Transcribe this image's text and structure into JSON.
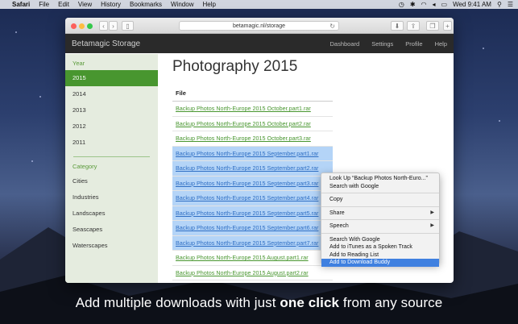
{
  "menubar": {
    "items": [
      "Safari",
      "File",
      "Edit",
      "View",
      "History",
      "Bookmarks",
      "Window",
      "Help"
    ],
    "clock": "Wed 9:41 AM"
  },
  "browser": {
    "url": "betamagic.nl/storage"
  },
  "site": {
    "brand": "Betamagic Storage",
    "nav": [
      "Dashboard",
      "Settings",
      "Profile",
      "Help"
    ]
  },
  "sidebar": {
    "year_heading": "Year",
    "years": [
      "2015",
      "2014",
      "2013",
      "2012",
      "2011"
    ],
    "category_heading": "Category",
    "categories": [
      "Cities",
      "Industries",
      "Landscapes",
      "Seascapes",
      "Waterscapes"
    ]
  },
  "main": {
    "title": "Photography 2015",
    "column_header": "File",
    "files": [
      "Backup Photos North-Europe 2015 October.part1.rar",
      "Backup Photos North-Europe 2015 October.part2.rar",
      "Backup Photos North-Europe 2015 October.part3.rar",
      "Backup Photos North-Europe 2015 September.part1.rar",
      "Backup Photos North-Europe 2015 September.part2.rar",
      "Backup Photos North-Europe 2015 September.part3.rar",
      "Backup Photos North-Europe 2015 September.part4.rar",
      "Backup Photos North-Europe 2015 September.part5.rar",
      "Backup Photos North-Europe 2015 September.part6.rar",
      "Backup Photos North-Europe 2015 September.part7.rar",
      "Backup Photos North-Europe 2015 August.part1.rar",
      "Backup Photos North-Europe 2015 August.part2.rar"
    ]
  },
  "context_menu": {
    "look_up": "Look Up “Backup Photos North-Euro...”",
    "search_google": "Search with Google",
    "copy": "Copy",
    "share": "Share",
    "speech": "Speech",
    "search_google_2": "Search With Google",
    "itunes": "Add to iTunes as a Spoken Track",
    "reading_list": "Add to Reading List",
    "download_buddy": "Add to Download Buddy"
  },
  "caption": {
    "before": "Add multiple downloads with just ",
    "bold": "one click",
    "after": " from any source"
  },
  "colors": {
    "accent_green": "#48962f",
    "selection_blue": "#b4d4f7",
    "menu_highlight": "#3f80e0",
    "navbar": "#2a2a2a"
  }
}
